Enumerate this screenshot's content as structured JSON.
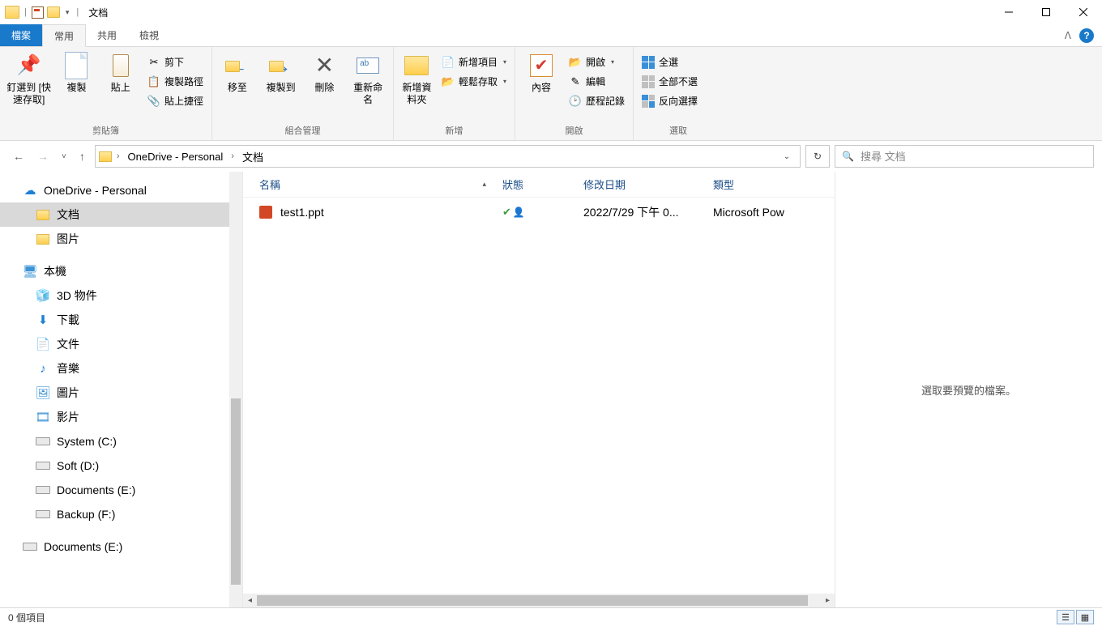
{
  "title": "文档",
  "tabs": {
    "file": "檔案",
    "home": "常用",
    "share": "共用",
    "view": "檢視"
  },
  "ribbon": {
    "clipboard": {
      "pin": "釘選到 [快速存取]",
      "copy": "複製",
      "paste": "貼上",
      "cut": "剪下",
      "copy_path": "複製路徑",
      "paste_shortcut": "貼上捷徑",
      "group": "剪貼簿"
    },
    "organize": {
      "move_to": "移至",
      "copy_to": "複製到",
      "delete": "刪除",
      "rename": "重新命名",
      "group": "組合管理"
    },
    "new": {
      "new_folder": "新增資料夾",
      "new_item": "新增項目",
      "easy_access": "輕鬆存取",
      "group": "新增"
    },
    "open": {
      "properties": "內容",
      "open": "開啟",
      "edit": "編輯",
      "history": "歷程記錄",
      "group": "開啟"
    },
    "select": {
      "select_all": "全選",
      "select_none": "全部不選",
      "invert": "反向選擇",
      "group": "選取"
    }
  },
  "breadcrumb": {
    "root": "OneDrive - Personal",
    "folder": "文档"
  },
  "search": {
    "placeholder": "搜尋 文档"
  },
  "tree": {
    "onedrive": "OneDrive - Personal",
    "documents": "文档",
    "pictures": "图片",
    "this_pc": "本機",
    "objects3d": "3D 物件",
    "downloads": "下載",
    "documents2": "文件",
    "music": "音樂",
    "pictures2": "圖片",
    "videos": "影片",
    "system_c": "System (C:)",
    "soft_d": "Soft (D:)",
    "docs_e": "Documents (E:)",
    "backup_f": "Backup (F:)",
    "docs_e2": "Documents (E:)"
  },
  "columns": {
    "name": "名稱",
    "state": "狀態",
    "modified": "修改日期",
    "type": "類型"
  },
  "files": [
    {
      "name": "test1.ppt",
      "modified": "2022/7/29 下午 0...",
      "type": "Microsoft Pow"
    }
  ],
  "preview_msg": "選取要預覽的檔案。",
  "status": "0 個項目"
}
